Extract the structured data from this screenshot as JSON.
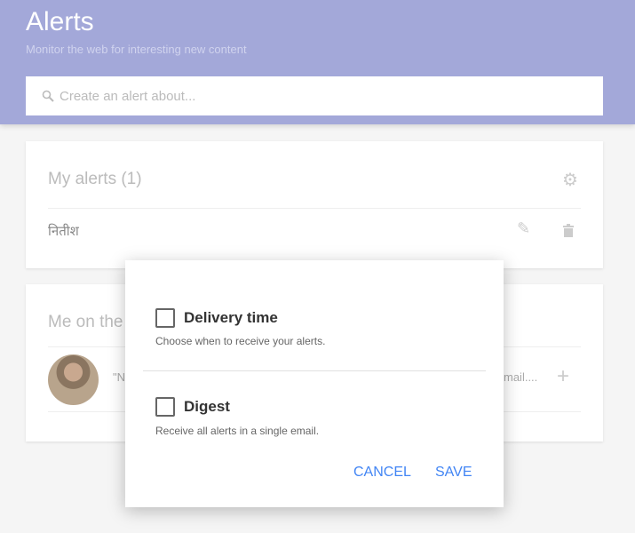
{
  "header": {
    "title": "Alerts",
    "subtitle": "Monitor the web for interesting new content",
    "search_placeholder": "Create an alert about..."
  },
  "my_alerts": {
    "title": "My alerts (1)",
    "items": [
      {
        "label": "नितीश"
      }
    ]
  },
  "me_on_web": {
    "title_visible": "Me on the",
    "row_text_start": "\"N",
    "row_text_end": "mail...."
  },
  "dialog": {
    "options": [
      {
        "label": "Delivery time",
        "description": "Choose when to receive your alerts.",
        "checked": false
      },
      {
        "label": "Digest",
        "description": "Receive all alerts in a single email.",
        "checked": false
      }
    ],
    "cancel_label": "CANCEL",
    "save_label": "SAVE"
  },
  "colors": {
    "header": "#a3a8d9",
    "accent": "#4285f4"
  }
}
